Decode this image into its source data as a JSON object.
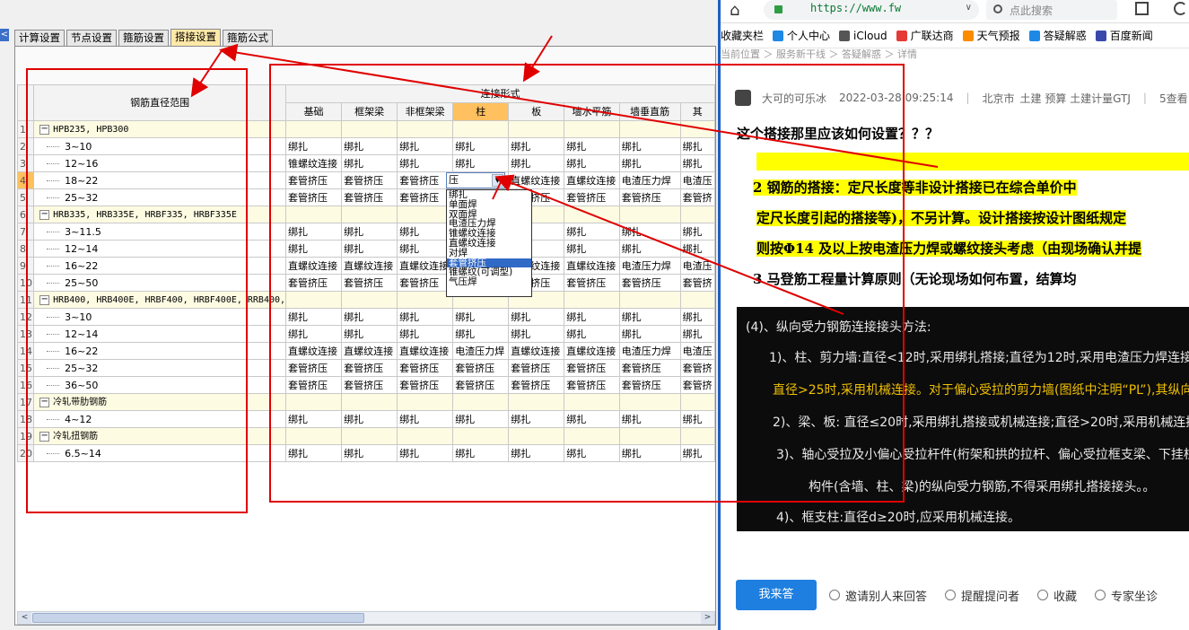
{
  "app": {
    "left_edge_glyph": "<",
    "tabs": [
      {
        "label": "计算设置",
        "active": false
      },
      {
        "label": "节点设置",
        "active": false
      },
      {
        "label": "箍筋设置",
        "active": false
      },
      {
        "label": "搭接设置",
        "active": true
      },
      {
        "label": "箍筋公式",
        "active": false
      }
    ]
  },
  "grid": {
    "header_range": "钢筋直径范围",
    "header_group": "连接形式",
    "columns": [
      "基础",
      "框架梁",
      "非框架梁",
      "柱",
      "板",
      "墙水平筋",
      "墙垂直筋",
      "其"
    ],
    "current_column": 3,
    "current_row": 4,
    "rows": [
      {
        "n": "1",
        "type": "group",
        "name": "HPB235, HPB300"
      },
      {
        "n": "2",
        "type": "item",
        "name": "3~10",
        "cells": [
          "绑扎",
          "绑扎",
          "绑扎",
          "绑扎",
          "绑扎",
          "绑扎",
          "绑扎",
          "绑扎"
        ]
      },
      {
        "n": "3",
        "type": "item",
        "name": "12~16",
        "cells": [
          "锥螺纹连接",
          "绑扎",
          "绑扎",
          "绑扎",
          "绑扎",
          "绑扎",
          "绑扎",
          "绑扎"
        ]
      },
      {
        "n": "4",
        "type": "item",
        "name": "18~22",
        "cells": [
          "套管挤压",
          "套管挤压",
          "套管挤压",
          "",
          "直螺纹连接",
          "直螺纹连接",
          "电渣压力焊",
          "电渣压"
        ]
      },
      {
        "n": "5",
        "type": "item",
        "name": "25~32",
        "cells": [
          "套管挤压",
          "套管挤压",
          "套管挤压",
          "",
          "套管挤压",
          "套管挤压",
          "套管挤压",
          "套管挤"
        ]
      },
      {
        "n": "6",
        "type": "group",
        "name": "HRB335, HRB335E, HRBF335, HRBF335E"
      },
      {
        "n": "7",
        "type": "item",
        "name": "3~11.5",
        "cells": [
          "绑扎",
          "绑扎",
          "绑扎",
          "",
          "绑扎",
          "绑扎",
          "绑扎",
          "绑扎"
        ]
      },
      {
        "n": "8",
        "type": "item",
        "name": "12~14",
        "cells": [
          "绑扎",
          "绑扎",
          "绑扎",
          "",
          "绑扎",
          "绑扎",
          "绑扎",
          "绑扎"
        ]
      },
      {
        "n": "9",
        "type": "item",
        "name": "16~22",
        "cells": [
          "直螺纹连接",
          "直螺纹连接",
          "直螺纹连接",
          "",
          "直螺纹连接",
          "直螺纹连接",
          "电渣压力焊",
          "电渣压"
        ]
      },
      {
        "n": "10",
        "type": "item",
        "name": "25~50",
        "cells": [
          "套管挤压",
          "套管挤压",
          "套管挤压",
          "",
          "套管挤压",
          "套管挤压",
          "套管挤压",
          "套管挤"
        ]
      },
      {
        "n": "11",
        "type": "group",
        "name": "HRB400, HRB400E, HRBF400, HRBF400E, RRB400,"
      },
      {
        "n": "12",
        "type": "item",
        "name": "3~10",
        "cells": [
          "绑扎",
          "绑扎",
          "绑扎",
          "绑扎",
          "绑扎",
          "绑扎",
          "绑扎",
          "绑扎"
        ]
      },
      {
        "n": "13",
        "type": "item",
        "name": "12~14",
        "cells": [
          "绑扎",
          "绑扎",
          "绑扎",
          "绑扎",
          "绑扎",
          "绑扎",
          "绑扎",
          "绑扎"
        ]
      },
      {
        "n": "14",
        "type": "item",
        "name": "16~22",
        "cells": [
          "直螺纹连接",
          "直螺纹连接",
          "直螺纹连接",
          "电渣压力焊",
          "直螺纹连接",
          "直螺纹连接",
          "电渣压力焊",
          "电渣压"
        ]
      },
      {
        "n": "15",
        "type": "item",
        "name": "25~32",
        "cells": [
          "套管挤压",
          "套管挤压",
          "套管挤压",
          "套管挤压",
          "套管挤压",
          "套管挤压",
          "套管挤压",
          "套管挤"
        ]
      },
      {
        "n": "16",
        "type": "item",
        "name": "36~50",
        "cells": [
          "套管挤压",
          "套管挤压",
          "套管挤压",
          "套管挤压",
          "套管挤压",
          "套管挤压",
          "套管挤压",
          "套管挤"
        ]
      },
      {
        "n": "17",
        "type": "group",
        "name": "冷轧带肋钢筋"
      },
      {
        "n": "18",
        "type": "item",
        "name": "4~12",
        "cells": [
          "绑扎",
          "绑扎",
          "绑扎",
          "绑扎",
          "绑扎",
          "绑扎",
          "绑扎",
          "绑扎"
        ]
      },
      {
        "n": "19",
        "type": "group",
        "name": "冷轧扭钢筋"
      },
      {
        "n": "20",
        "type": "item",
        "name": "6.5~14",
        "cells": [
          "绑扎",
          "绑扎",
          "绑扎",
          "绑扎",
          "绑扎",
          "绑扎",
          "绑扎",
          "绑扎"
        ]
      }
    ]
  },
  "combo": {
    "value": "压",
    "arrow": "▼",
    "options": [
      "绑扎",
      "单面焊",
      "双面焊",
      "电渣压力焊",
      "锥螺纹连接",
      "直螺纹连接",
      "对焊",
      "套管挤压",
      "锥螺纹(可调型)",
      "气压焊"
    ],
    "selected": 7
  },
  "scrollbar": {
    "left": "<",
    "right": ">"
  },
  "browser": {
    "home_glyph": "⌂",
    "url": "https://www.fw",
    "search_placeholder": "点此搜索",
    "bookmarks": [
      {
        "label": "收藏夹栏",
        "color": ""
      },
      {
        "label": "个人中心",
        "color": "#1e88e5"
      },
      {
        "label": "iCloud",
        "color": "#555555"
      },
      {
        "label": "广联达商",
        "color": "#e53935"
      },
      {
        "label": "天气预报",
        "color": "#fb8c00"
      },
      {
        "label": "答疑解惑",
        "color": "#1e88e5"
      },
      {
        "label": "百度新闻",
        "color": "#3949ab"
      }
    ]
  },
  "post": {
    "breadcrumb": "当前位置 ＞ 服务新干线 ＞ 答疑解惑 ＞ 详情",
    "author": "大可的可乐冰",
    "datetime": "2022-03-28 09:25:14",
    "location": "北京市",
    "tags": "土建 预算 土建计量GTJ",
    "views": "5查看",
    "title": "这个搭接那里应该如何设置？？？",
    "doc_lines": [
      "2   钢筋的搭接：定尺长度等非设计搭接已在综合单价中",
      "定尺长度引起的搭接等)，不另计算。设计搭接按设计图纸规定",
      "则按Φ14 及以上按电渣压力焊或螺纹接头考虑（由现场确认并提",
      "3   马登筋工程量计算原则（无论现场如何布置，结算均"
    ],
    "image_lines": [
      "(4)、纵向受力钢筋连接接头方法:",
      "1)、柱、剪力墙:直径<12时,采用绑扎搭接;直径为12时,采用电渣压力焊连接;直径为14~25时,采",
      "直径>25时,采用机械连接。对于偏心受拉的剪力墙(图纸中注明“PL”),其纵向受力钢筋应采用机",
      "2)、梁、板: 直径≤20时,采用绑扎搭接或机械连接;直径>20时,采用机械连接。",
      "3)、轴心受拉及小偏心受拉杆件(桁架和拱的拉杆、偏心受拉框支梁、下挂柱、下挂板等)、结构图中",
      "构件(含墙、柱、梁)的纵向受力钢筋,不得采用绑扎搭接接头。。",
      "4)、框支柱:直径d≥20时,应采用机械连接。"
    ],
    "answer_button": "我来答",
    "actions": [
      "邀请别人来回答",
      "提醒提问者",
      "收藏",
      "专家坐诊"
    ]
  }
}
